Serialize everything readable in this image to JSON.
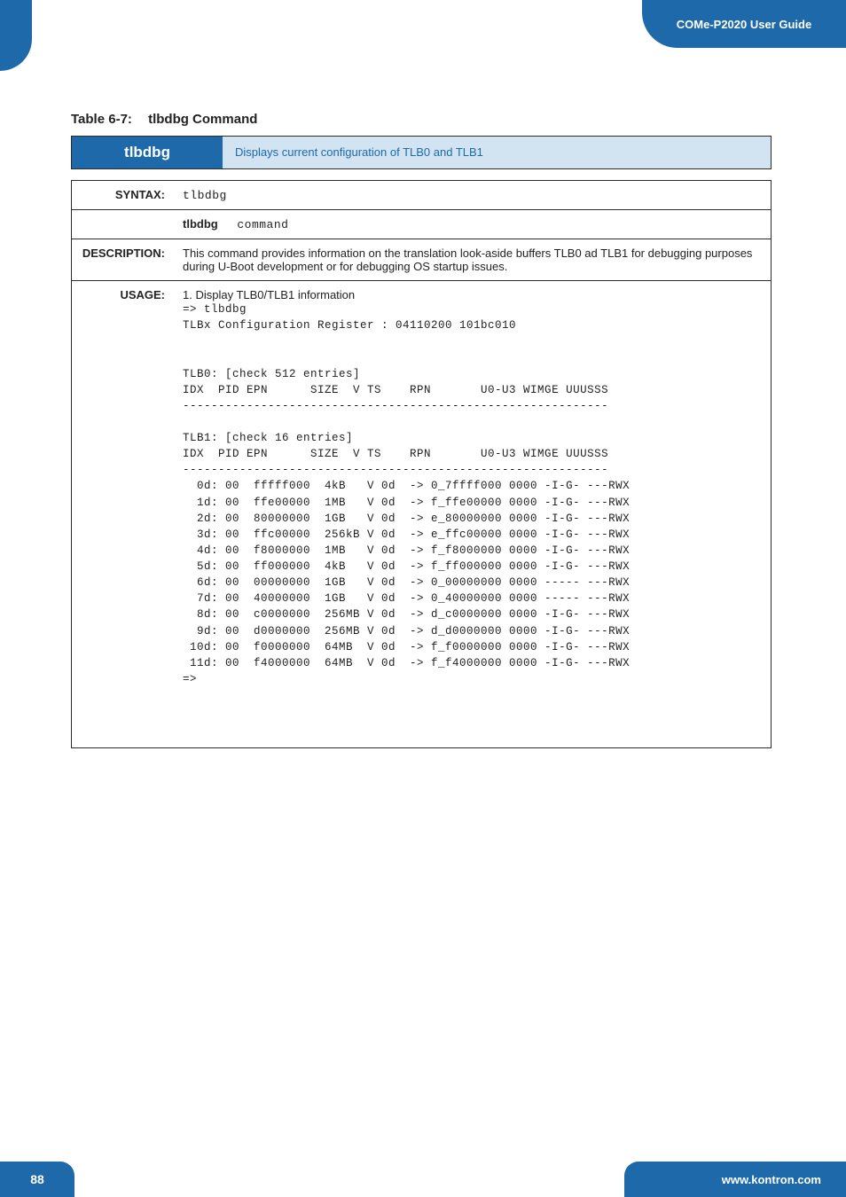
{
  "header": {
    "title": "COMe-P2020 User Guide"
  },
  "caption": {
    "label": "Table 6-7:",
    "title": "tlbdbg Command"
  },
  "cmd": {
    "name": "tlbdbg",
    "short_desc": "Displays current configuration of TLB0 and TLB1"
  },
  "syntax": {
    "label": "SYNTAX:",
    "value": "tlbdbg",
    "subcmd_label": "tlbdbg",
    "subcmd_value": "command"
  },
  "description": {
    "label": "DESCRIPTION:",
    "text": "This command provides information on the translation look-aside buffers TLB0 ad TLB1 for debugging purposes during U-Boot development or for debugging OS startup issues."
  },
  "usage": {
    "label": "USAGE:",
    "intro": "1. Display TLB0/TLB1 information",
    "block": "=> tlbdbg\nTLBx Configuration Register : 04110200 101bc010\n\n\nTLB0: [check 512 entries]\nIDX  PID EPN      SIZE  V TS    RPN       U0-U3 WIMGE UUUSSS\n------------------------------------------------------------\n\nTLB1: [check 16 entries]\nIDX  PID EPN      SIZE  V TS    RPN       U0-U3 WIMGE UUUSSS\n------------------------------------------------------------\n  0d: 00  fffff000  4kB   V 0d  -> 0_7ffff000 0000 -I-G- ---RWX\n  1d: 00  ffe00000  1MB   V 0d  -> f_ffe00000 0000 -I-G- ---RWX\n  2d: 00  80000000  1GB   V 0d  -> e_80000000 0000 -I-G- ---RWX\n  3d: 00  ffc00000  256kB V 0d  -> e_ffc00000 0000 -I-G- ---RWX\n  4d: 00  f8000000  1MB   V 0d  -> f_f8000000 0000 -I-G- ---RWX\n  5d: 00  ff000000  4kB   V 0d  -> f_ff000000 0000 -I-G- ---RWX\n  6d: 00  00000000  1GB   V 0d  -> 0_00000000 0000 ----- ---RWX\n  7d: 00  40000000  1GB   V 0d  -> 0_40000000 0000 ----- ---RWX\n  8d: 00  c0000000  256MB V 0d  -> d_c0000000 0000 -I-G- ---RWX\n  9d: 00  d0000000  256MB V 0d  -> d_d0000000 0000 -I-G- ---RWX\n 10d: 00  f0000000  64MB  V 0d  -> f_f0000000 0000 -I-G- ---RWX\n 11d: 00  f4000000  64MB  V 0d  -> f_f4000000 0000 -I-G- ---RWX\n=>"
  },
  "footer": {
    "page": "88",
    "url": "www.kontron.com"
  }
}
